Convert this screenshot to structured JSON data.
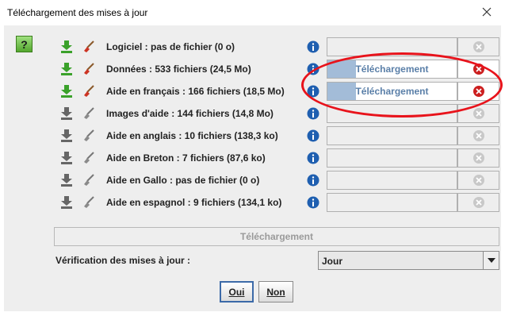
{
  "window": {
    "title": "Téléchargement des mises à jour"
  },
  "icons": {
    "help": "question-icon",
    "download": "download-arrow-icon",
    "delete": "broom-icon",
    "info": "info-icon",
    "cancel": "cancel-circle-icon",
    "close": "close-icon"
  },
  "colors": {
    "download_active": "#3aa12a",
    "download_inactive": "#666666",
    "info_blue": "#1f5fb0",
    "cancel_active": "#cc1f1f",
    "cancel_inactive": "#c8c8c8",
    "progress_fill": "#a3bcd8",
    "highlight_oval": "#e8131b"
  },
  "help_button": {
    "label": "?"
  },
  "rows": [
    {
      "label": "Logiciel :  pas de fichier (0 o)",
      "active": true,
      "downloading": false,
      "progress": 0,
      "status": ""
    },
    {
      "label": "Données :  533 fichiers (24,5 Mo)",
      "active": true,
      "downloading": true,
      "progress": 0.22,
      "status": "Téléchargement"
    },
    {
      "label": "Aide en français :  166 fichiers (18,5 Mo)",
      "active": true,
      "downloading": true,
      "progress": 0.22,
      "status": "Téléchargement"
    },
    {
      "label": "Images d'aide :  144 fichiers (14,8 Mo)",
      "active": false,
      "downloading": false,
      "progress": 0,
      "status": ""
    },
    {
      "label": "Aide en anglais :  10 fichiers (138,3 ko)",
      "active": false,
      "downloading": false,
      "progress": 0,
      "status": ""
    },
    {
      "label": "Aide en Breton :  7 fichiers (87,6 ko)",
      "active": false,
      "downloading": false,
      "progress": 0,
      "status": ""
    },
    {
      "label": "Aide en Gallo :  pas de fichier (0 o)",
      "active": false,
      "downloading": false,
      "progress": 0,
      "status": ""
    },
    {
      "label": "Aide en espagnol :  9 fichiers (134,1 ko)",
      "active": false,
      "downloading": false,
      "progress": 0,
      "status": ""
    }
  ],
  "main_download_button": {
    "label": "Téléchargement"
  },
  "verification": {
    "label": "Vérification des mises à jour :",
    "selected": "Jour"
  },
  "buttons": {
    "yes": "Oui",
    "no": "Non"
  }
}
